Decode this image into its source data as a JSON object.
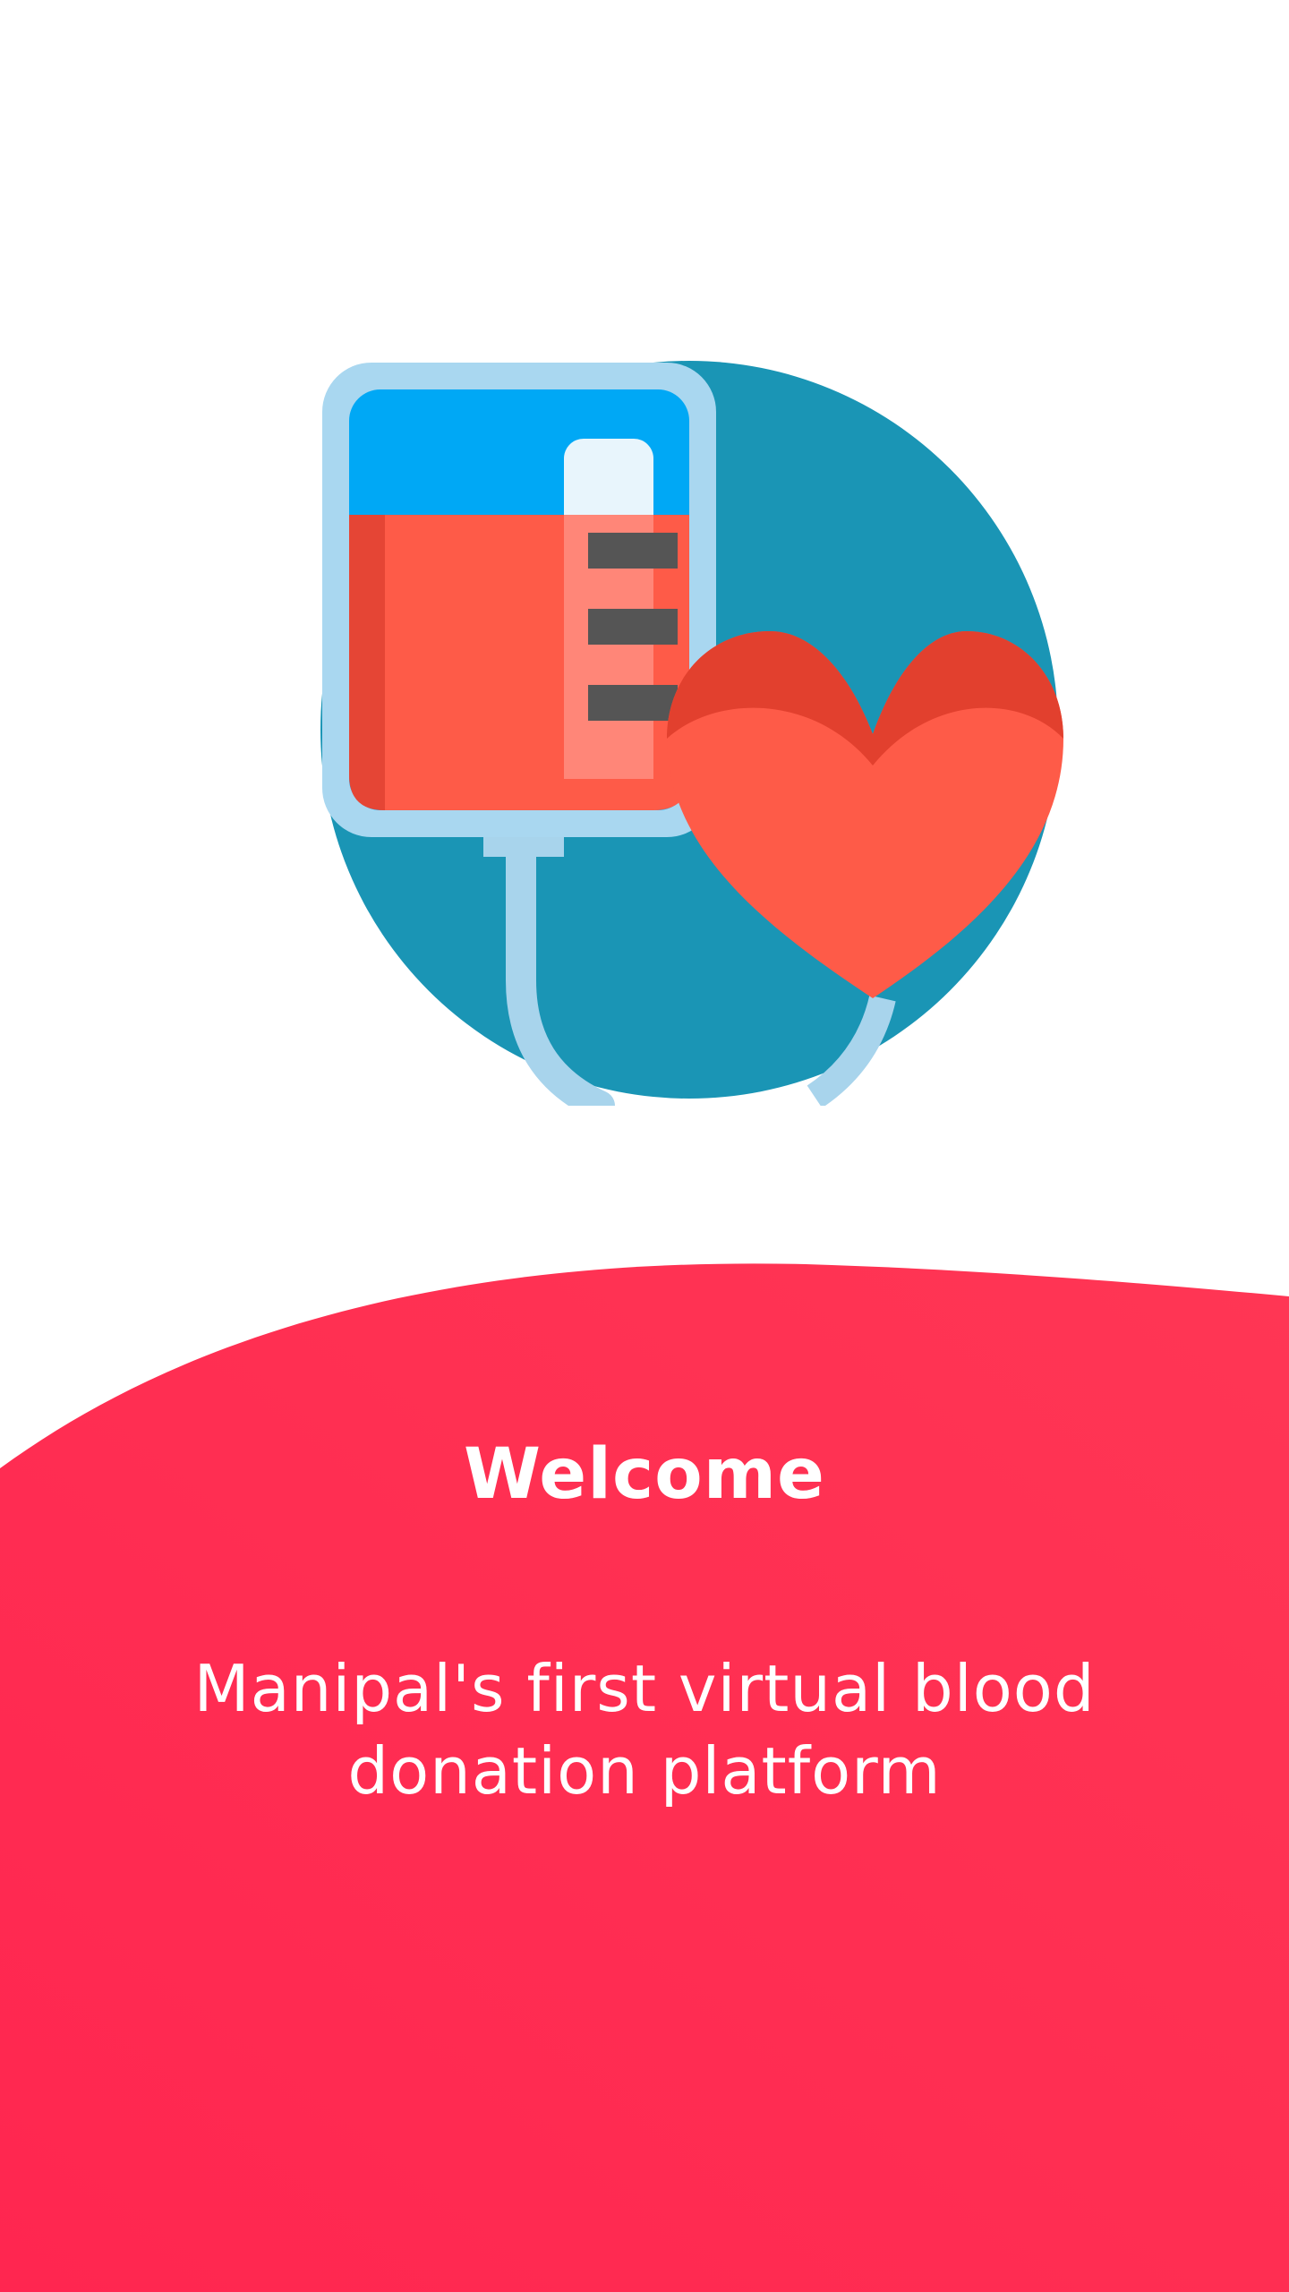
{
  "welcome": {
    "title": "Welcome",
    "tagline": "Manipal's first virtual blood donation platform"
  },
  "illustration": {
    "icon": "blood-bag-heart-icon"
  },
  "colors": {
    "background": "#ffffff",
    "accent_red": "#ff2d55",
    "circle_teal": "#1a95b5",
    "bag_blue": "#00a8f5",
    "blood_red": "#fe5b48"
  }
}
